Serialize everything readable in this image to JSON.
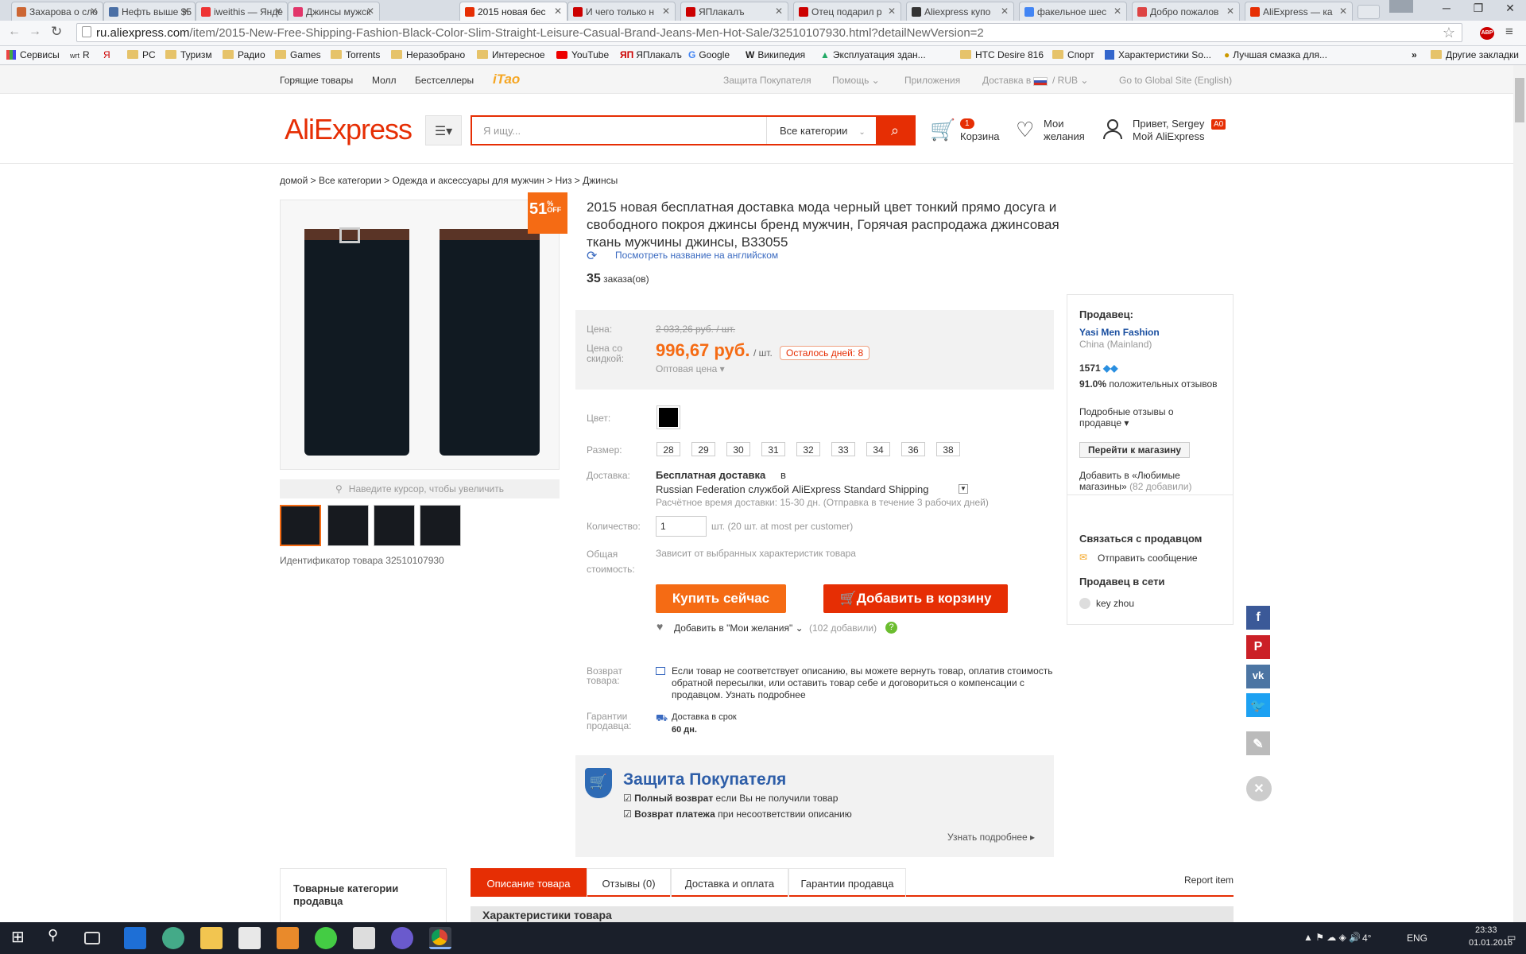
{
  "browser": {
    "tabs": [
      {
        "title": "Захарова о сло",
        "color": "#c63"
      },
      {
        "title": "Нефть выше $5",
        "color": "#4a6fa5"
      },
      {
        "title": "iweithis — Янде",
        "color": "#e33"
      },
      {
        "title": "Джинсы мужск",
        "color": "#e2366b"
      },
      {
        "title": "2015 новая бес",
        "color": "#e62e04"
      },
      {
        "title": "И чего только н",
        "color": "#c00"
      },
      {
        "title": "ЯПлакалъ",
        "color": "#c00"
      },
      {
        "title": "Отец подарил р",
        "color": "#c00"
      },
      {
        "title": "Aliexpress купо",
        "color": "#333"
      },
      {
        "title": "факельное шес",
        "color": "#4285f4"
      },
      {
        "title": "Добро пожалов",
        "color": "#d44"
      },
      {
        "title": "AliExpress — ка",
        "color": "#e62e04"
      }
    ],
    "url_host": "ru.aliexpress.com",
    "url_path": "/item/2015-New-Free-Shipping-Fashion-Black-Color-Slim-Straight-Leisure-Casual-Brand-Jeans-Men-Hot-Sale/32510107930.html?detailNewVersion=2",
    "ext_abp": "ABP",
    "bookmarks": [
      "Сервисы",
      "R",
      "PC",
      "Туризм",
      "Радио",
      "Games",
      "Torrents",
      "Неразобрано",
      "Интересное",
      "YouTube",
      "ЯПлакалъ",
      "Google",
      "Википедия",
      "Эксплуатация здан...",
      "HTC Desire 816",
      "Спорт",
      "Характеристики So...",
      "Лучшая смазка для...",
      "»",
      "Другие закладки"
    ]
  },
  "topnav": {
    "left": [
      "Горящие товары",
      "Молл",
      "Бестселлеры",
      "iTao"
    ],
    "right": [
      "Защита Покупателя",
      "Помощь ⌄",
      "Приложения",
      "Доставка в",
      "/ RUB ⌄",
      "Go to Global Site (English)"
    ]
  },
  "header": {
    "logo": "AliExpress",
    "search_placeholder": "Я ищу...",
    "category": "Все категории",
    "cart_count": "1",
    "cart_label": "Корзина",
    "wishlist_l1": "Мои",
    "wishlist_l2": "желания",
    "greeting": "Привет, Sergey",
    "user_badge": "A0",
    "myali": "Мой AliExpress"
  },
  "breadcrumb": "домой > Все категории > Одежда и аксессуары для мужчин > Низ > Джинсы",
  "product": {
    "discount": "51",
    "discount_pct": "%",
    "discount_off": "OFF",
    "zoom_hint": "Наведите курсор, чтобы увеличить",
    "product_id": "Идентификатор товара 32510107930",
    "title": "2015 новая бесплатная доставка мода черный цвет тонкий прямо досуга и свободного покроя джинсы бренд мужчин, Горячая распродажа джинсовая ткань мужчины джинсы, B33055",
    "english_link": "Посмотреть название на английском",
    "orders_count": "35",
    "orders_label": "заказа(ов)",
    "price_label": "Цена:",
    "old_price": "2 033,26 руб. / шт.",
    "discount_label": "Цена со скидкой:",
    "new_price": "996,67 руб.",
    "per_unit": "/ шт.",
    "days_left": "Осталось дней: 8",
    "wholesale": "Оптовая цена",
    "color_label": "Цвет:",
    "color_value": "#000000",
    "size_label": "Размер:",
    "sizes": [
      "28",
      "29",
      "30",
      "31",
      "32",
      "33",
      "34",
      "36",
      "38"
    ],
    "delivery_label": "Доставка:",
    "delivery_free": "Бесплатная доставка",
    "delivery_in": "в",
    "delivery_country": "Russian Federation службой AliExpress Standard Shipping",
    "delivery_time": "Расчётное время доставки: 15-30 дн. (Отправка в течение 3 рабочих дней)",
    "qty_label": "Количество:",
    "qty_value": "1",
    "qty_note": "шт. (20 шт. at most per customer)",
    "total_label_1": "Общая",
    "total_label_2": "стоимость:",
    "total_value": "Зависит от выбранных характеристик товара",
    "buy_now": "Купить сейчас",
    "add_cart": "Добавить в корзину",
    "add_wish": "Добавить в \"Мои желания\"",
    "wish_count": "(102 добавили)",
    "return_label": "Возврат товара:",
    "return_text": "Если товар не соответствует описанию, вы можете вернуть товар, оплатив стоимость обратной пересылки, или оставить товар себе и договориться о компенсации с продавцом. Узнать подробнее",
    "guarantee_label": "Гарантии продавца:",
    "guarantee_text": "Доставка в срок",
    "guarantee_days": "60 дн."
  },
  "seller": {
    "heading": "Продавец:",
    "name": "Yasi Men Fashion",
    "country": "China (Mainland)",
    "score": "1571",
    "positive_pct": "91.0%",
    "positive_text": "положительных отзывов",
    "feedback_link": "Подробные отзывы о продавце",
    "store_button": "Перейти к магазину",
    "fav_link": "Добавить в «Любимые магазины»",
    "fav_count": "(82 добавили)",
    "contact_heading": "Связаться с продавцом",
    "send_message": "Отправить сообщение",
    "online_heading": "Продавец в сети",
    "online_user": "key zhou"
  },
  "protection": {
    "title": "Защита Покупателя",
    "line1_bold": "Полный возврат",
    "line1": "если Вы не получили товар",
    "line2_bold": "Возврат платежа",
    "line2": "при несоответствии описанию",
    "more": "Узнать подробнее"
  },
  "bottom": {
    "cat_title": "Товарные категории продавца",
    "tabs": [
      "Описание товара",
      "Отзывы (0)",
      "Доставка и оплата",
      "Гарантии продавца"
    ],
    "report": "Report item",
    "characteristics": "Характеристики товара"
  },
  "taskbar": {
    "lang": "ENG",
    "temp": "4°",
    "time": "23:33",
    "date": "01.01.2016"
  }
}
